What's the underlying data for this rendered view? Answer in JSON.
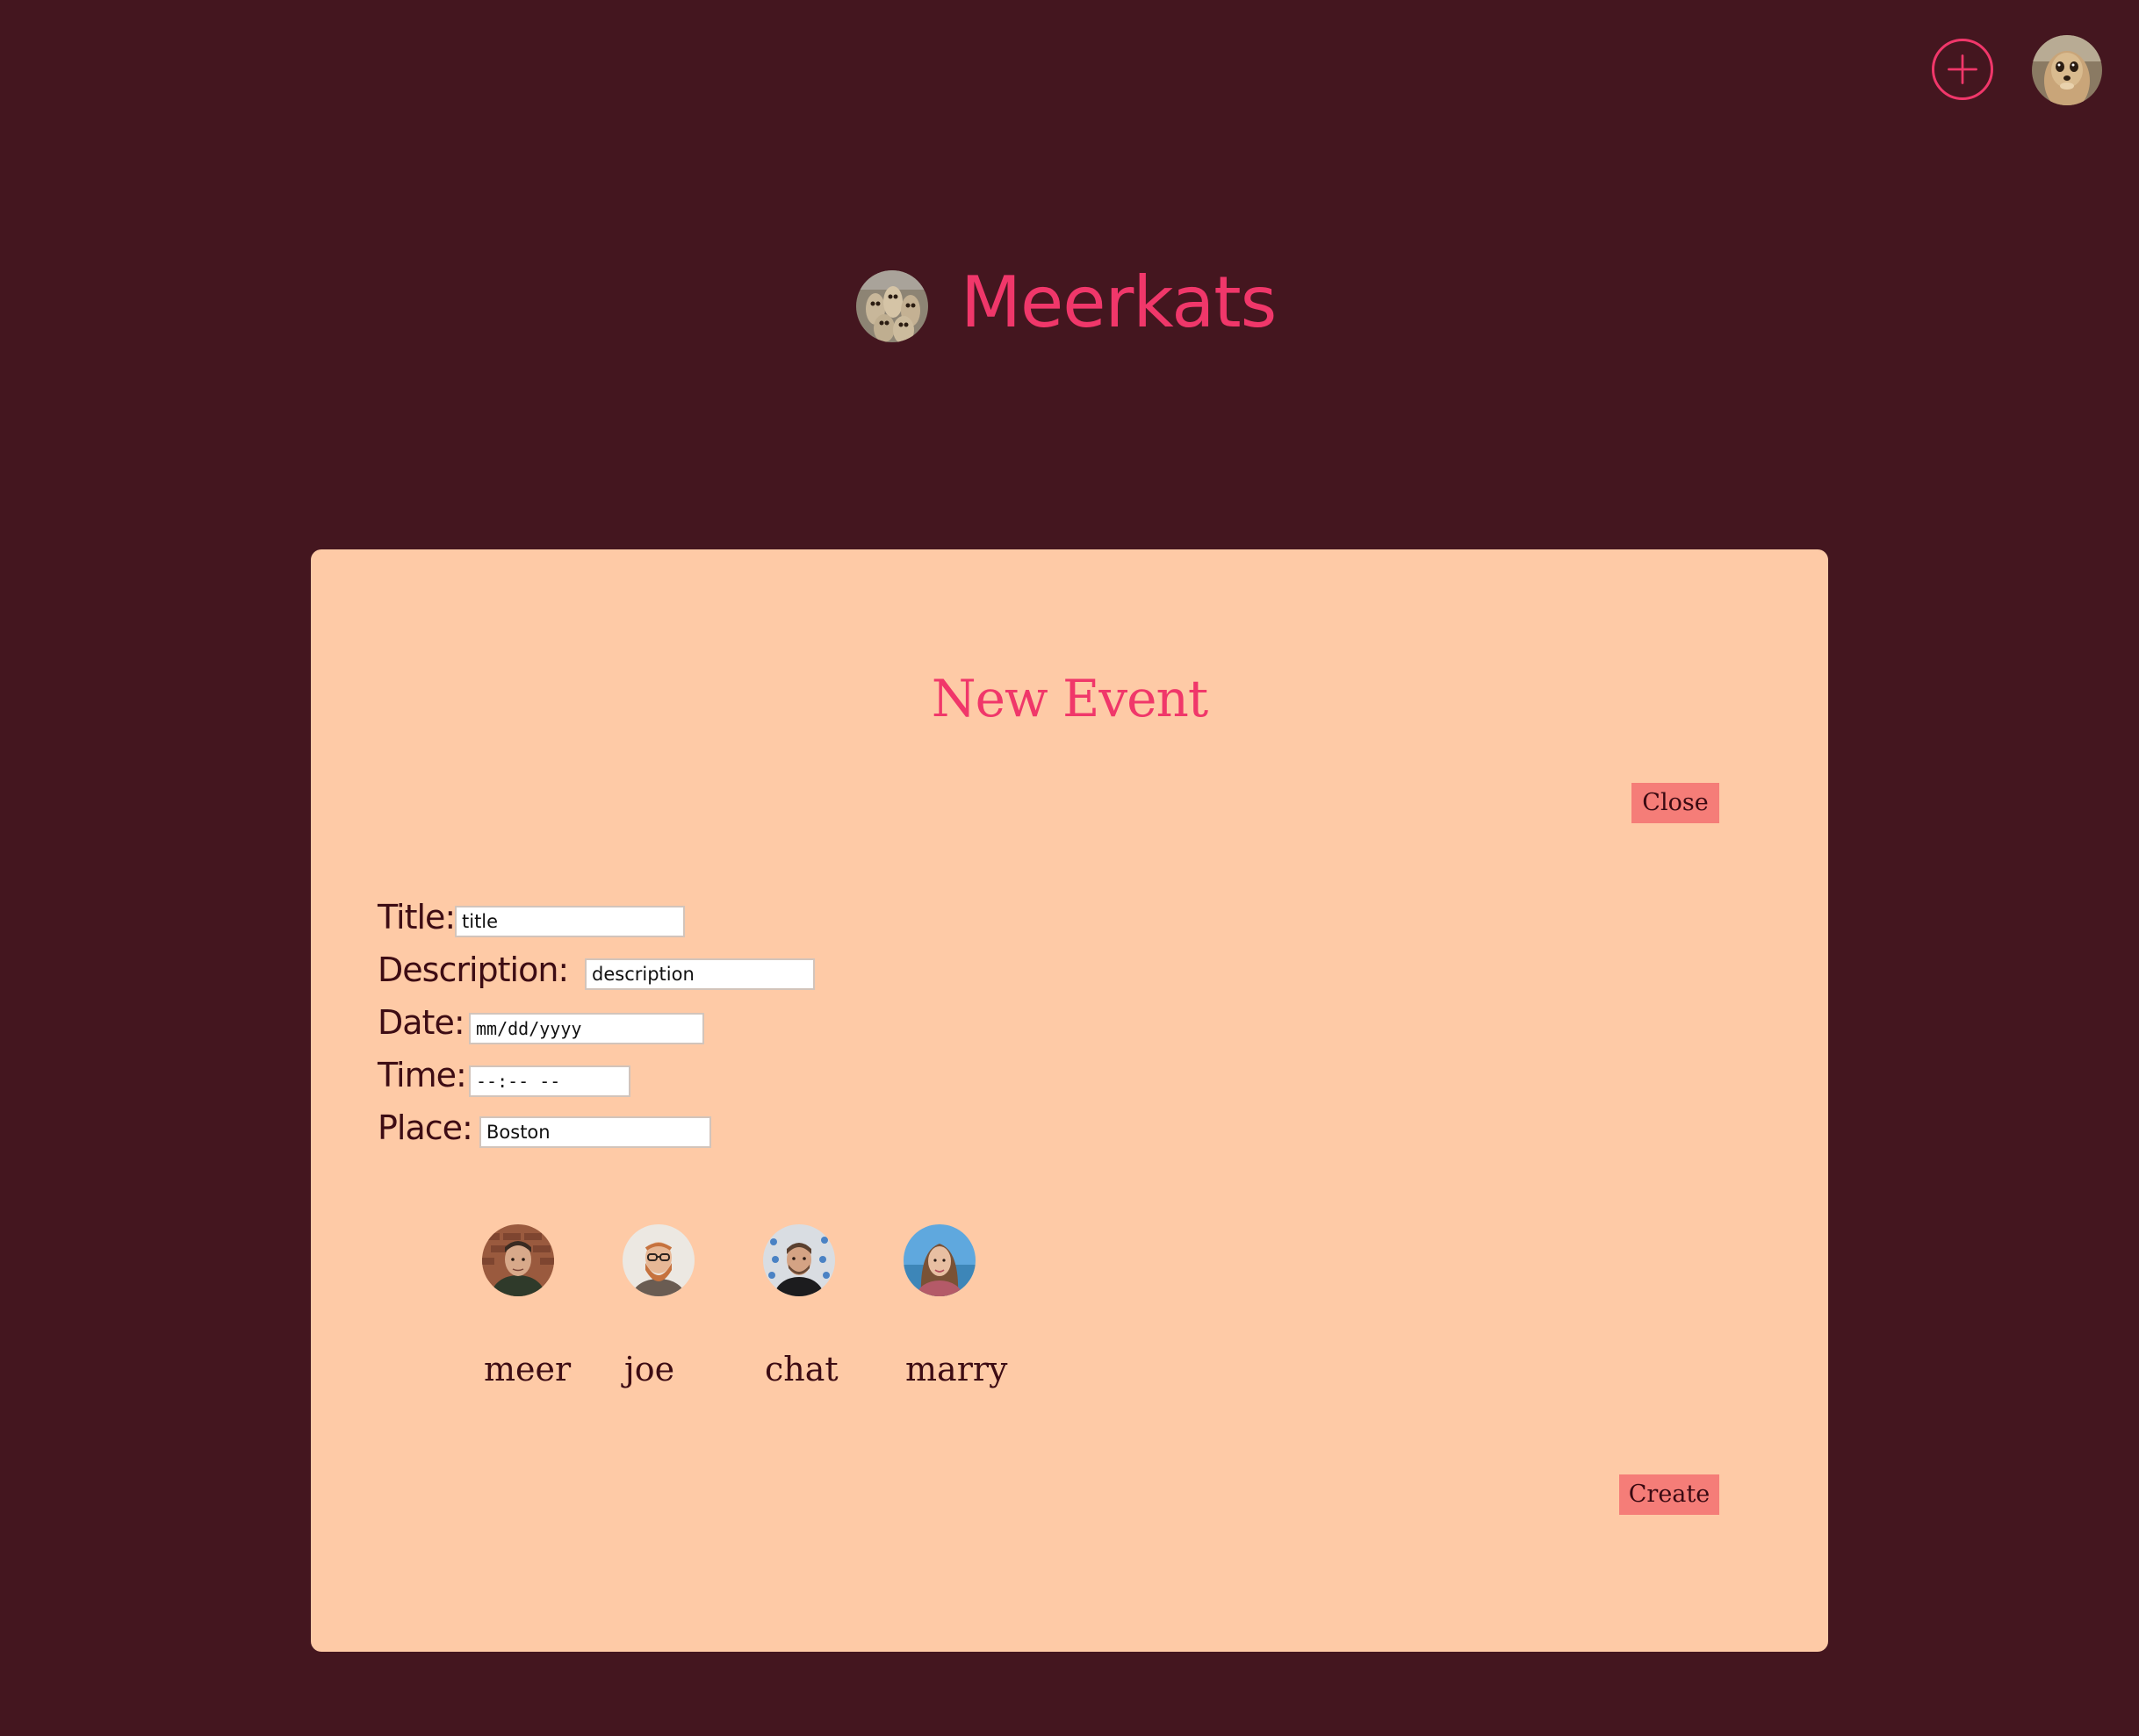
{
  "header": {
    "add_icon": "plus-circle-icon",
    "user_avatar": "meerkat-avatar"
  },
  "brand": {
    "logo": "meerkats-group-logo",
    "name": "Meerkats"
  },
  "modal": {
    "title": "New Event",
    "close_label": "Close",
    "create_label": "Create",
    "fields": {
      "title": {
        "label": "Title:",
        "value": "title"
      },
      "description": {
        "label": "Description:",
        "value": "description"
      },
      "date": {
        "label": "Date:",
        "value": "mm/dd/yyyy"
      },
      "time": {
        "label": "Time:",
        "value": "--:-- --"
      },
      "place": {
        "label": "Place:",
        "value": "Boston"
      }
    },
    "members": [
      {
        "name": "meer"
      },
      {
        "name": "joe"
      },
      {
        "name": "chat"
      },
      {
        "name": "marry"
      }
    ]
  },
  "colors": {
    "background": "#44161f",
    "accent": "#f0376a",
    "modal_bg": "#fecaa6",
    "button_bg": "#f57d78",
    "text_dark": "#3d0c14"
  }
}
